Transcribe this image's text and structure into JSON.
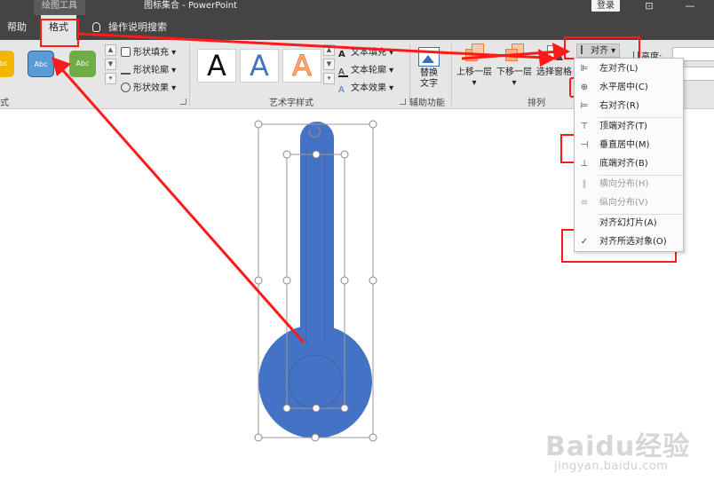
{
  "titlebar": {
    "context_tab": "绘图工具",
    "document_title": "图标集合 - PowerPoint",
    "login_label": "登录"
  },
  "tabs": {
    "help": "帮助",
    "format": "格式",
    "tell_me": "操作说明搜索"
  },
  "ribbon": {
    "shape_styles": {
      "swatches": [
        {
          "label": "Abc",
          "color": "#f2b705"
        },
        {
          "label": "Abc",
          "color": "#5b9bd5"
        },
        {
          "label": "Abc",
          "color": "#70ad47"
        }
      ],
      "shape_fill": "形状填充",
      "shape_outline": "形状轮廓",
      "shape_effects": "形状效果",
      "group_label_partial": "式"
    },
    "wordart": {
      "samples": [
        "A",
        "A",
        "A"
      ],
      "text_fill": "文本填充",
      "text_outline": "文本轮廓",
      "text_effects": "文本效果",
      "group_label": "艺术字样式"
    },
    "accessibility": {
      "alt_text_line1": "替换",
      "alt_text_line2": "文字",
      "group_label": "辅助功能"
    },
    "arrange": {
      "bring_forward": "上移一层",
      "send_backward": "下移一层",
      "selection_pane": "选择窗格",
      "align_button": "对齐",
      "group_label": "排列"
    },
    "size": {
      "height_label": "高度:"
    }
  },
  "align_menu": {
    "items": [
      {
        "icon": "align-left-icon",
        "label": "左对齐(L)",
        "disabled": false
      },
      {
        "icon": "align-center-icon",
        "label": "水平居中(C)",
        "disabled": false
      },
      {
        "icon": "align-right-icon",
        "label": "右对齐(R)",
        "disabled": false
      },
      {
        "icon": "align-top-icon",
        "label": "顶端对齐(T)",
        "disabled": false
      },
      {
        "icon": "align-middle-icon",
        "label": "垂直居中(M)",
        "disabled": false
      },
      {
        "icon": "align-bottom-icon",
        "label": "底端对齐(B)",
        "disabled": false
      },
      {
        "icon": "distribute-horizontal-icon",
        "label": "横向分布(H)",
        "disabled": true
      },
      {
        "icon": "distribute-vertical-icon",
        "label": "纵向分布(V)",
        "disabled": true
      },
      {
        "icon": "",
        "label": "对齐幻灯片(A)",
        "disabled": false
      },
      {
        "icon": "checkmark-icon",
        "label": "对齐所选对象(O)",
        "disabled": false,
        "checked": true
      }
    ]
  },
  "colors": {
    "shape_fill": "#4472c4",
    "annotation_red": "#ff1a1a",
    "ribbon_bg": "#e6e6e6",
    "titlebar_bg": "#444444"
  },
  "watermark": {
    "logo": "Baidu经验",
    "url": "jingyan.baidu.com"
  }
}
